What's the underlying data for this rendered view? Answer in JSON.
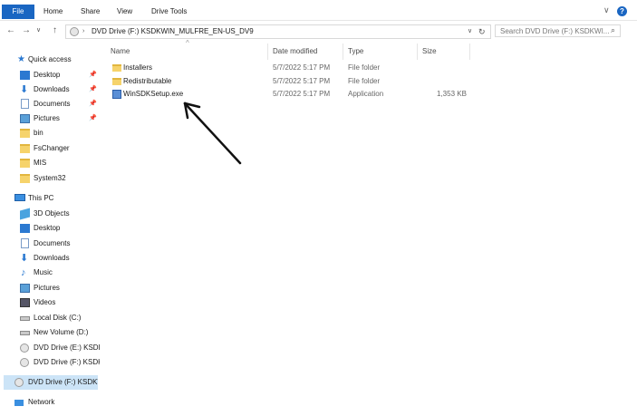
{
  "ribbon": {
    "tabs": [
      "File",
      "Home",
      "Share",
      "View",
      "Drive Tools"
    ],
    "collapse_symbol": "∨",
    "help_symbol": "?"
  },
  "address": {
    "path": "DVD Drive (F:) KSDKWIN_MULFRE_EN-US_DV9",
    "search_placeholder": "Search DVD Drive (F:) KSDKWI..."
  },
  "navigation": {
    "quick_access": "Quick access",
    "quick_items": [
      "Desktop",
      "Downloads",
      "Documents",
      "Pictures",
      "bin",
      "FsChanger",
      "MIS",
      "System32"
    ],
    "this_pc": "This PC",
    "pc_items": [
      "3D Objects",
      "Desktop",
      "Documents",
      "Downloads",
      "Music",
      "Pictures",
      "Videos",
      "Local Disk (C:)",
      "New Volume (D:)",
      "DVD Drive (E:) KSDK",
      "DVD Drive (F:) KSDK"
    ],
    "selected_drive": "DVD Drive (F:) KSDKV",
    "network": "Network"
  },
  "columns": {
    "name": "Name",
    "date": "Date modified",
    "type": "Type",
    "size": "Size"
  },
  "files": [
    {
      "name": "Installers",
      "date": "5/7/2022 5:17 PM",
      "type": "File folder",
      "size": "",
      "icon": "folder-icon"
    },
    {
      "name": "Redistributable",
      "date": "5/7/2022 5:17 PM",
      "type": "File folder",
      "size": "",
      "icon": "folder-icon"
    },
    {
      "name": "WinSDKSetup.exe",
      "date": "5/7/2022 5:17 PM",
      "type": "Application",
      "size": "1,353 KB",
      "icon": "setup-exe-icon"
    }
  ],
  "colors": {
    "accent": "#1a66c2",
    "folder": "#f6d36b",
    "selection": "#cce4f7",
    "annotation_arrow": "#111111"
  }
}
